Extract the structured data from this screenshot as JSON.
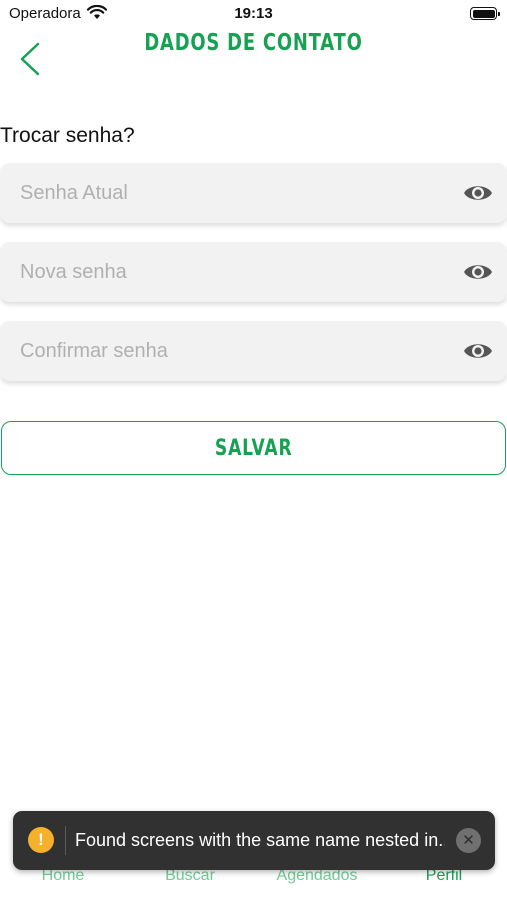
{
  "status_bar": {
    "carrier": "Operadora",
    "time": "19:13"
  },
  "header": {
    "title": "DADOS DE CONTATO"
  },
  "password_section": {
    "title": "Trocar senha?",
    "fields": [
      {
        "placeholder": "Senha Atual",
        "value": ""
      },
      {
        "placeholder": "Nova senha",
        "value": ""
      },
      {
        "placeholder": "Confirmar senha",
        "value": ""
      }
    ]
  },
  "save_button": {
    "label": "SALVAR"
  },
  "toast": {
    "message": "Found screens with the same name nested in..."
  },
  "tabs": [
    {
      "label": "Home"
    },
    {
      "label": "Buscar"
    },
    {
      "label": "Agendados"
    },
    {
      "label": "Perfil",
      "active": true
    }
  ],
  "colors": {
    "accent": "#17a153",
    "accent_light": "#6fcf97",
    "field_bg": "#f2f2f2",
    "toast_bg": "#313131",
    "warning": "#f5b12c"
  },
  "icons": {
    "back": "chevron-left-icon",
    "eye": "eye-icon",
    "warning": "warning-icon",
    "close": "close-icon",
    "wifi": "wifi-icon",
    "battery": "battery-icon"
  }
}
